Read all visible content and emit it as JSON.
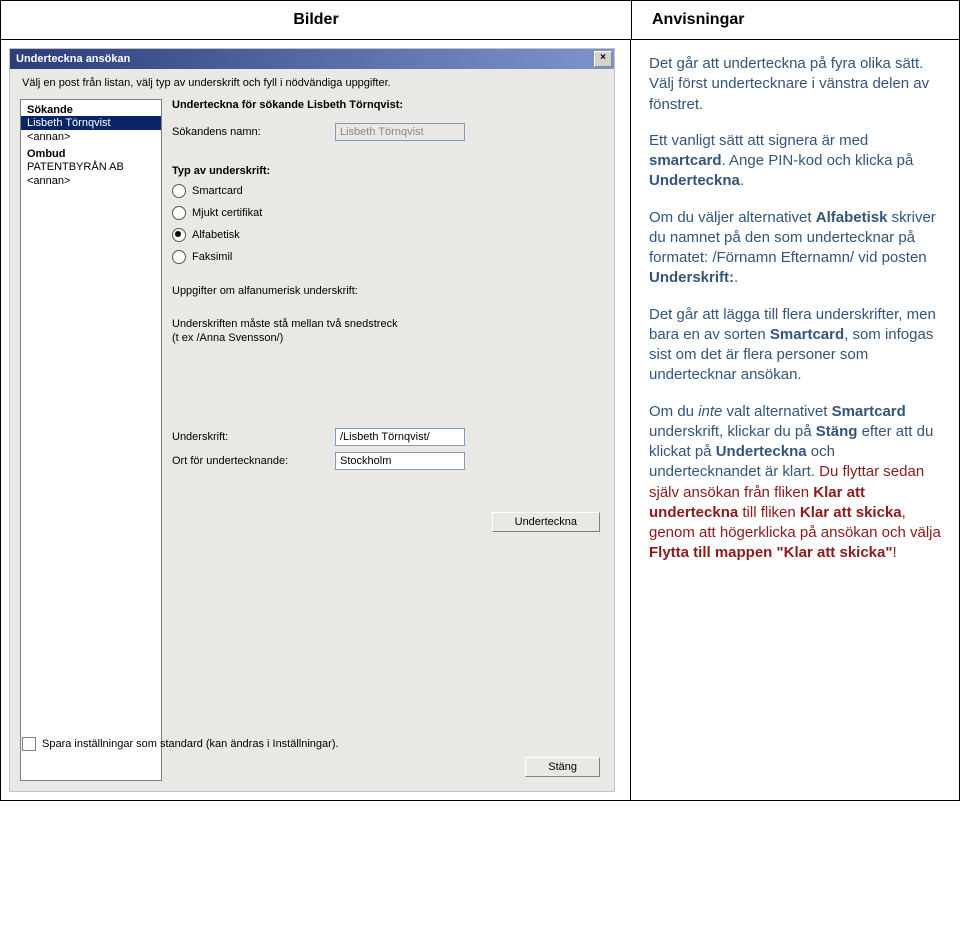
{
  "header": {
    "left": "Bilder",
    "right": "Anvisningar"
  },
  "dialog": {
    "title": "Underteckna ansökan",
    "intro": "Välj en post från listan, välj typ av underskrift och fyll i nödvändiga uppgifter.",
    "list": {
      "groups": [
        {
          "label": "Sökande",
          "items": [
            {
              "text": "Lisbeth Törnqvist",
              "selected": true
            },
            {
              "text": "<annan>",
              "selected": false
            }
          ]
        },
        {
          "label": "Ombud",
          "items": [
            {
              "text": "PATENTBYRÅN AB",
              "selected": false
            },
            {
              "text": "<annan>",
              "selected": false
            }
          ]
        }
      ]
    },
    "right": {
      "title_prefix": "Underteckna för sökande ",
      "title_name": "Lisbeth Törnqvist:",
      "applicant_label": "Sökandens namn:",
      "applicant_value": "Lisbeth Törnqvist",
      "type_label": "Typ av underskrift:",
      "radios": [
        {
          "label": "Smartcard",
          "checked": false
        },
        {
          "label": "Mjukt certifikat",
          "checked": false
        },
        {
          "label": "Alfabetisk",
          "checked": true
        },
        {
          "label": "Faksimil",
          "checked": false
        }
      ],
      "alpha_label": "Uppgifter om alfanumerisk underskrift:",
      "help1": "Underskriften måste stå mellan två snedstreck",
      "help2": "(t ex /Anna Svensson/)",
      "sign_label": "Underskrift:",
      "sign_value": "/Lisbeth Törnqvist/",
      "place_label": "Ort för undertecknande:",
      "place_value": "Stockholm",
      "btn_sign": "Underteckna",
      "save_label": "Spara inställningar som standard (kan ändras i Inställningar).",
      "btn_close": "Stäng"
    }
  },
  "instr": {
    "p1a": "Det går att underteckna på fyra olika sätt. Välj först undertecknare i vänstra delen av fönstret.",
    "p2a": "Ett vanligt sätt att signera är med ",
    "p2b": "smartcard",
    "p2c": ". Ange PIN-kod och klicka på ",
    "p2d": "Underteckna",
    "p2e": ".",
    "p3a": "Om du väljer alternativet ",
    "p3b": "Alfabetisk",
    "p3c": " skriver du namnet på den som undertecknar på formatet: /Förnamn Efternamn/ vid posten ",
    "p3d": "Underskrift:",
    "p3e": ".",
    "p4a": "Det går att lägga till flera underskrifter, men bara en av sorten ",
    "p4b": "Smartcard",
    "p4c": ", som infogas sist om det är flera personer som undertecknar ansökan.",
    "p5a": "Om du ",
    "p5b": "inte",
    "p5c": " valt alternativet ",
    "p5d": "Smartcard",
    "p5e": " underskrift, klickar du på ",
    "p5f": "Stäng",
    "p5g": " efter att du klickat på ",
    "p5h": "Underteckna",
    "p5i": " och undertecknandet är klart. ",
    "p5j": "Du flyttar sedan själv ansökan från fliken ",
    "p5k": "Klar att underteckna",
    "p5l": " till fliken ",
    "p5m": "Klar att skicka",
    "p5n": ", genom att högerklicka på ansökan och välja ",
    "p5o": "Flytta till mappen \"Klar att skicka\"",
    "p5p": "!"
  }
}
